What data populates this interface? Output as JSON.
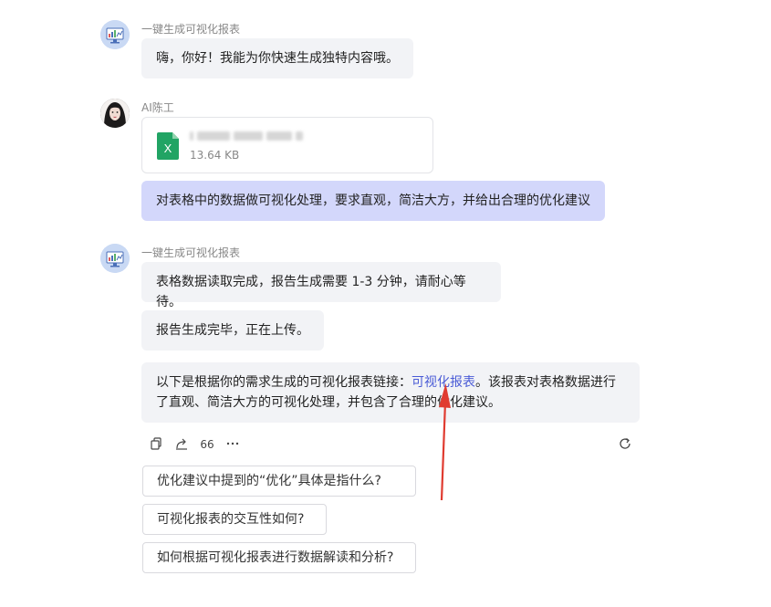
{
  "conversation": {
    "bot_name": "一键生成可视化报表",
    "user_name": "AI陈工",
    "greeting": "嗨，你好！我能为你快速生成独特内容哦。",
    "file": {
      "size": "13.64 KB",
      "icon": "excel-file-icon"
    },
    "user_message": "对表格中的数据做可视化处理，要求直观，简洁大方，并给出合理的优化建议",
    "bot_reply_1": "表格数据读取完成，报告生成需要 1-3 分钟，请耐心等待。",
    "bot_reply_2": "报告生成完毕，正在上传。",
    "bot_reply_3": {
      "prefix": "以下是根据你的需求生成的可视化报表链接：",
      "link": "可视化报表",
      "suffix_line1": "。该报表对表格数据进行",
      "line2": "了直观、简洁大方的可视化处理，并包含了合理的优化建议。"
    }
  },
  "actions": {
    "copy": "copy-icon",
    "share": "share-icon",
    "quote": "quote-icon",
    "more": "more-icon",
    "regenerate": "refresh-icon"
  },
  "suggestions": [
    "优化建议中提到的“优化”具体是指什么?",
    "可视化报表的交互性如何?",
    "如何根据可视化报表进行数据解读和分析?"
  ],
  "colors": {
    "bot_bubble": "#f2f3f6",
    "user_bubble": "#d3d7fb",
    "link": "#4a5bd6",
    "arrow": "#e03b30",
    "excel_green": "#21a464"
  }
}
